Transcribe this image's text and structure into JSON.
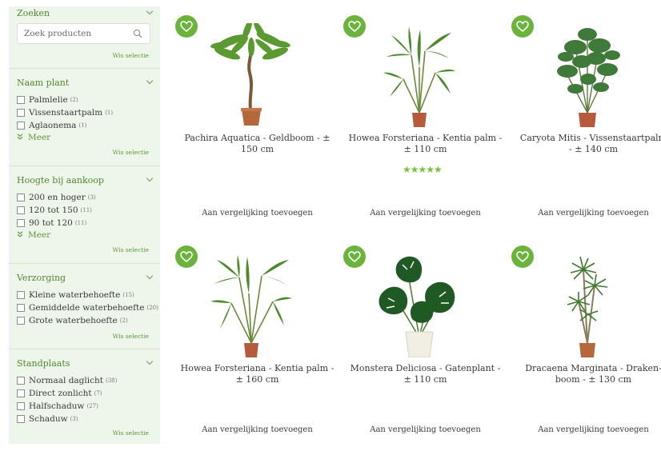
{
  "filters": {
    "search": {
      "title": "Zoeken",
      "placeholder": "Zoek producten",
      "clear": "Wis selectie"
    },
    "naam": {
      "title": "Naam plant",
      "options": [
        {
          "label": "Palmlelie",
          "count": "(2)"
        },
        {
          "label": "Vissenstaartpalm",
          "count": "(1)"
        },
        {
          "label": "Aglaonema",
          "count": "(1)"
        }
      ],
      "more": "Meer",
      "clear": "Wis selectie"
    },
    "hoogte": {
      "title": "Hoogte bij aankoop",
      "options": [
        {
          "label": "200 en hoger",
          "count": "(3)"
        },
        {
          "label": "120 tot 150",
          "count": "(11)"
        },
        {
          "label": "90 tot 120",
          "count": "(11)"
        }
      ],
      "more": "Meer",
      "clear": "Wis selectie"
    },
    "verzorging": {
      "title": "Verzorging",
      "options": [
        {
          "label": "Kleine waterbehoefte",
          "count": "(15)"
        },
        {
          "label": "Gemiddelde waterbehoefte",
          "count": "(20)"
        },
        {
          "label": "Grote waterbehoefte",
          "count": "(2)"
        }
      ],
      "clear": "Wis selectie"
    },
    "standplaats": {
      "title": "Standplaats",
      "options": [
        {
          "label": "Normaal daglicht",
          "count": "(38)"
        },
        {
          "label": "Direct zonlicht",
          "count": "(7)"
        },
        {
          "label": "Halfschaduw",
          "count": "(27)"
        },
        {
          "label": "Schaduw",
          "count": "(3)"
        }
      ],
      "clear": "Wis selectie"
    }
  },
  "products": [
    {
      "line1": "Pachira Aquatica - Geldboom - ±",
      "line2": "150 cm",
      "compare": "Aan vergelijking toevoegen",
      "plant": "pachira-plant-image",
      "pot": "#b5683b"
    },
    {
      "line1": "Howea Forsteriana - Kentia palm -",
      "line2": "± 110 cm",
      "compare": "Aan vergelijking toevoegen",
      "plant": "kentia-palm-image",
      "pot": "#b65a3e",
      "rating": "★★★★★",
      "rating_value": 5
    },
    {
      "line1": "Caryota Mitis - Vissenstaartpalm",
      "line2": "- ± 140 cm",
      "compare": "Aan vergelijking toevoegen",
      "plant": "caryota-plant-image",
      "pot": "#b65a3e"
    },
    {
      "line1": "Howea Forsteriana - Kentia palm -",
      "line2": "± 160 cm",
      "compare": "Aan vergelijking toevoegen",
      "plant": "kentia-palm-image",
      "pot": "#b65a3e"
    },
    {
      "line1": "Monstera Deliciosa - Gatenplant -",
      "line2": "± 110 cm",
      "compare": "Aan vergelijking toevoegen",
      "plant": "monstera-plant-image",
      "pot": "#f1eee4"
    },
    {
      "line1": "Dracaena Marginata - Draken-",
      "line2": "boom - ± 130 cm",
      "compare": "Aan vergelijking toevoegen",
      "plant": "dracaena-plant-image",
      "pot": "#b5683b"
    }
  ],
  "colors": {
    "accent": "#6bb33d",
    "sidebar_bg": "#eef5ea",
    "title": "#4f8a2e"
  }
}
